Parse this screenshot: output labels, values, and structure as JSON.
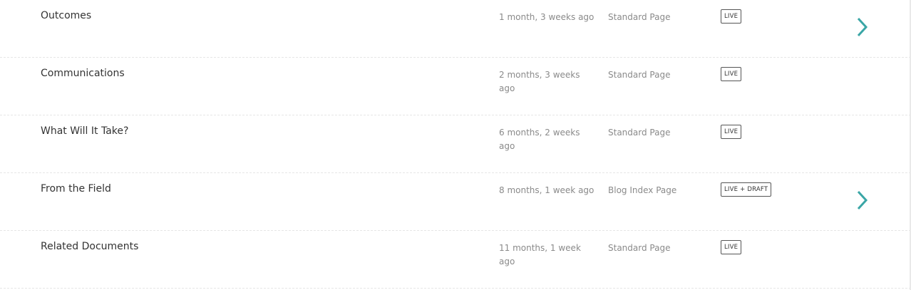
{
  "pages": [
    {
      "title": "Outcomes",
      "updated": "1 month, 3 weeks ago",
      "type": "Standard Page",
      "status": "LIVE",
      "has_children": true
    },
    {
      "title": "Communications",
      "updated": "2 months, 3 weeks ago",
      "type": "Standard Page",
      "status": "LIVE",
      "has_children": false
    },
    {
      "title": "What Will It Take?",
      "updated": "6 months, 2 weeks ago",
      "type": "Standard Page",
      "status": "LIVE",
      "has_children": false
    },
    {
      "title": "From the Field",
      "updated": "8 months, 1 week ago",
      "type": "Blog Index Page",
      "status": "LIVE + DRAFT",
      "has_children": true
    },
    {
      "title": "Related Documents",
      "updated": "11 months, 1 week ago",
      "type": "Standard Page",
      "status": "LIVE",
      "has_children": false
    }
  ],
  "icons": {
    "child_pages": "chevron-right-icon"
  },
  "colors": {
    "accent": "#3aa6a6"
  }
}
